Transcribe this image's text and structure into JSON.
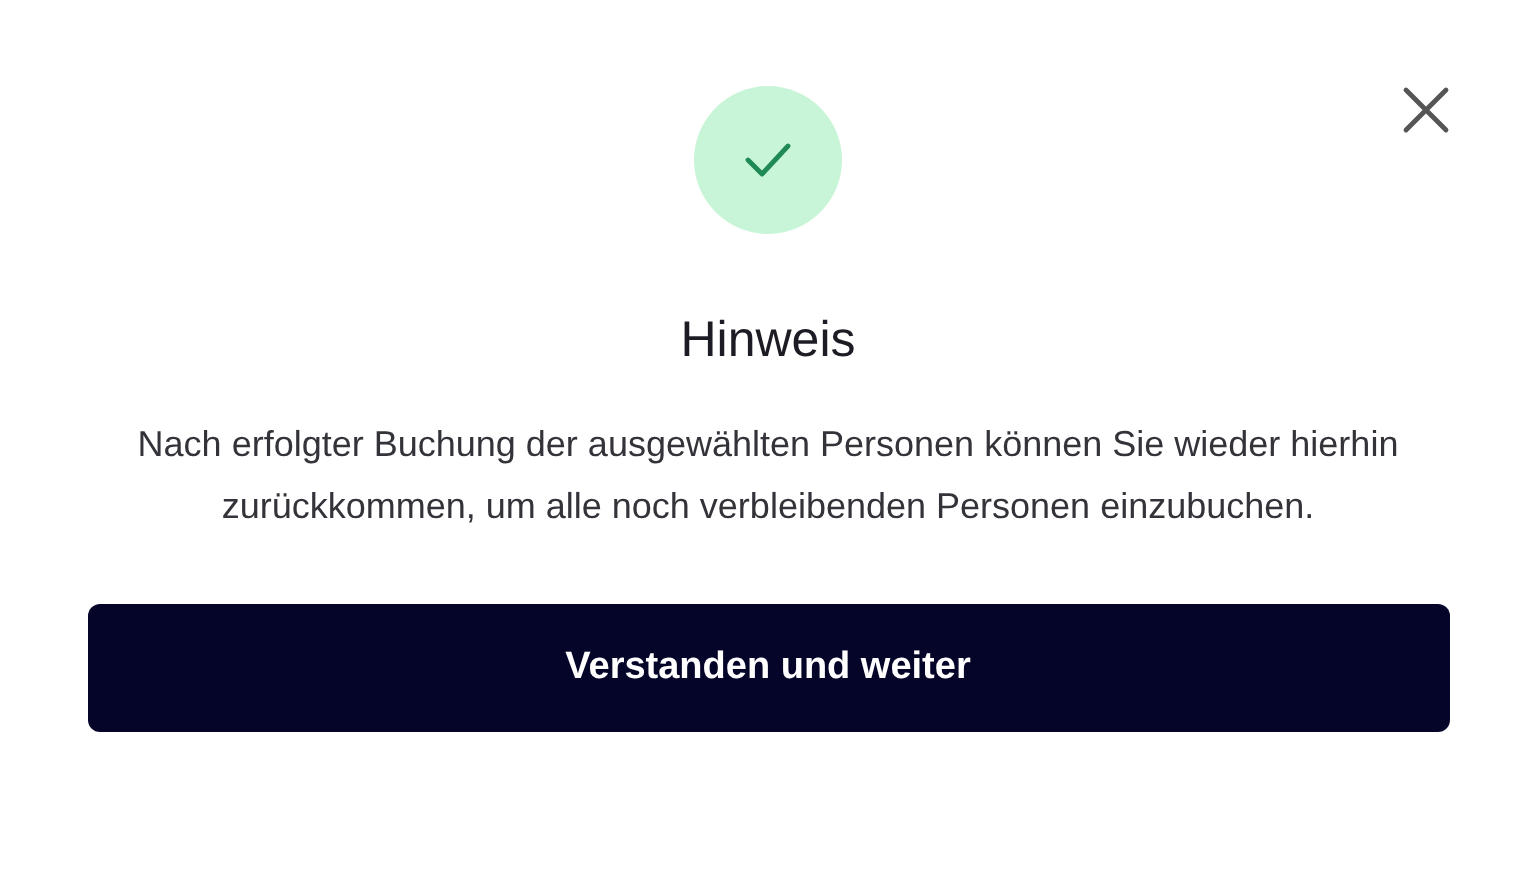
{
  "dialog": {
    "title": "Hinweis",
    "message": "Nach erfolgter Buchung der ausgewählten Personen können Sie wieder hierhin zurückkommen, um alle noch verbleibenden Personen einzubuchen.",
    "button": "Verstanden und weiter"
  }
}
